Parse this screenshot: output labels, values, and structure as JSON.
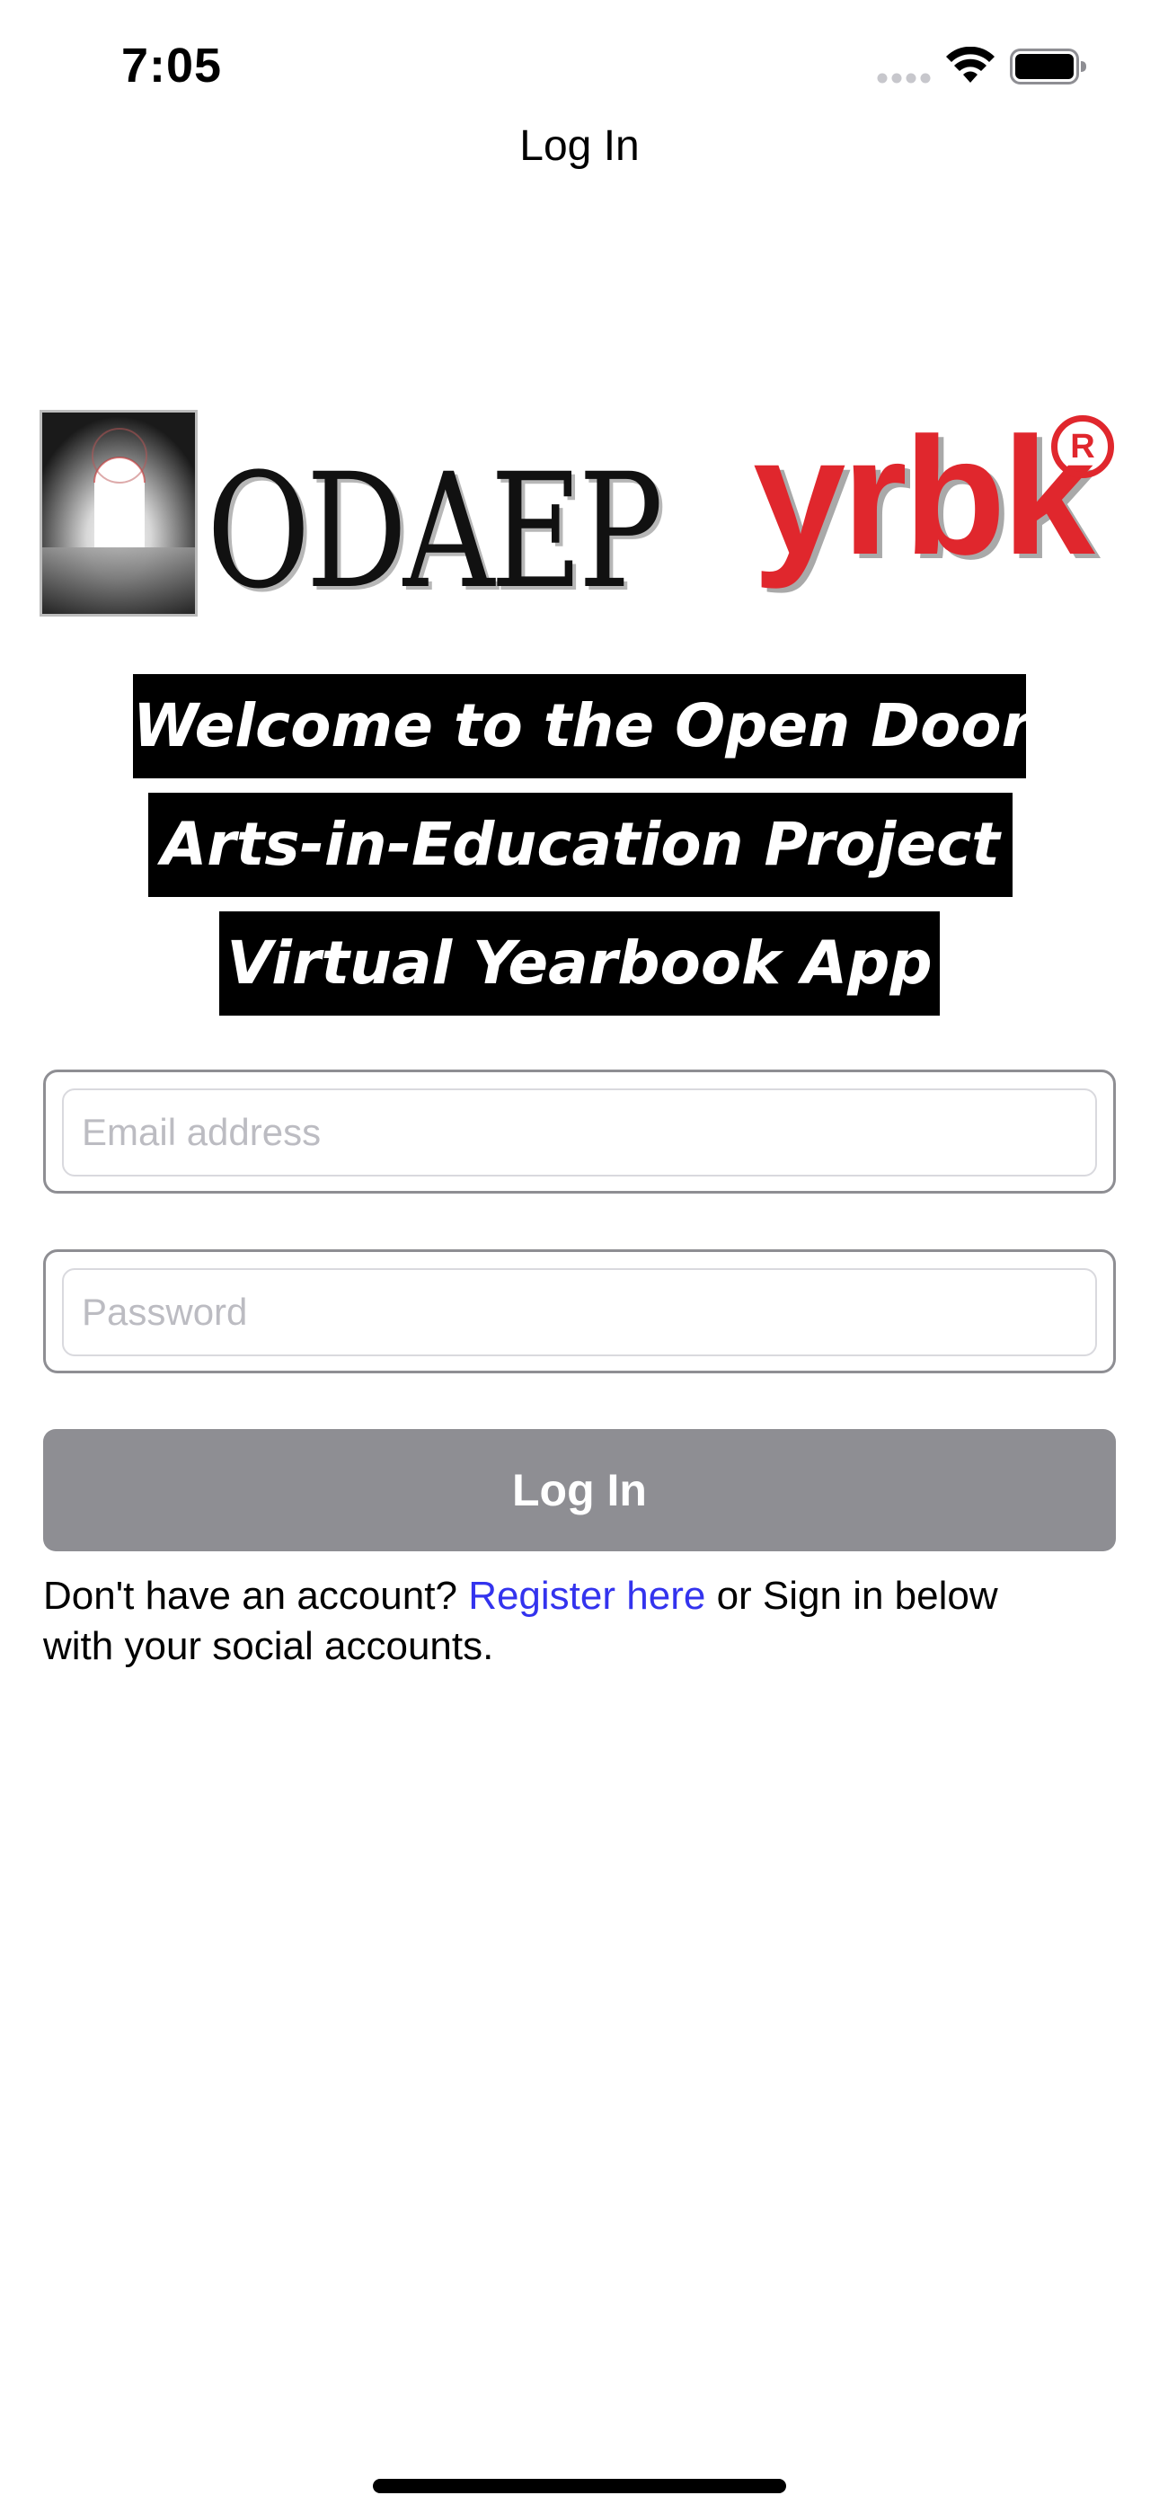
{
  "status_bar": {
    "time": "7:05",
    "signal_icon": "cellular-signal-icon",
    "wifi_icon": "wifi-icon",
    "battery_icon": "battery-icon"
  },
  "nav": {
    "title": "Log In"
  },
  "logo": {
    "door_icon": "open-door-icon",
    "wordmark_main": "ODAEP",
    "wordmark_accent": "yrbk",
    "registered_mark": "R",
    "accent_color": "#e0272d"
  },
  "welcome": {
    "line1": "Welcome to the Open Door",
    "line2": "Arts-in-Education Project",
    "line3": "Virtual Yearbook App"
  },
  "form": {
    "email": {
      "value": "",
      "placeholder": "Email address"
    },
    "password": {
      "value": "",
      "placeholder": "Password"
    },
    "login_label": "Log In",
    "login_button_color": "#8e8e93"
  },
  "helper": {
    "prefix": "Don't have an account?",
    "register_link": "Register here",
    "suffix": "or Sign in below with your social accounts.",
    "link_color": "#3333ee"
  }
}
